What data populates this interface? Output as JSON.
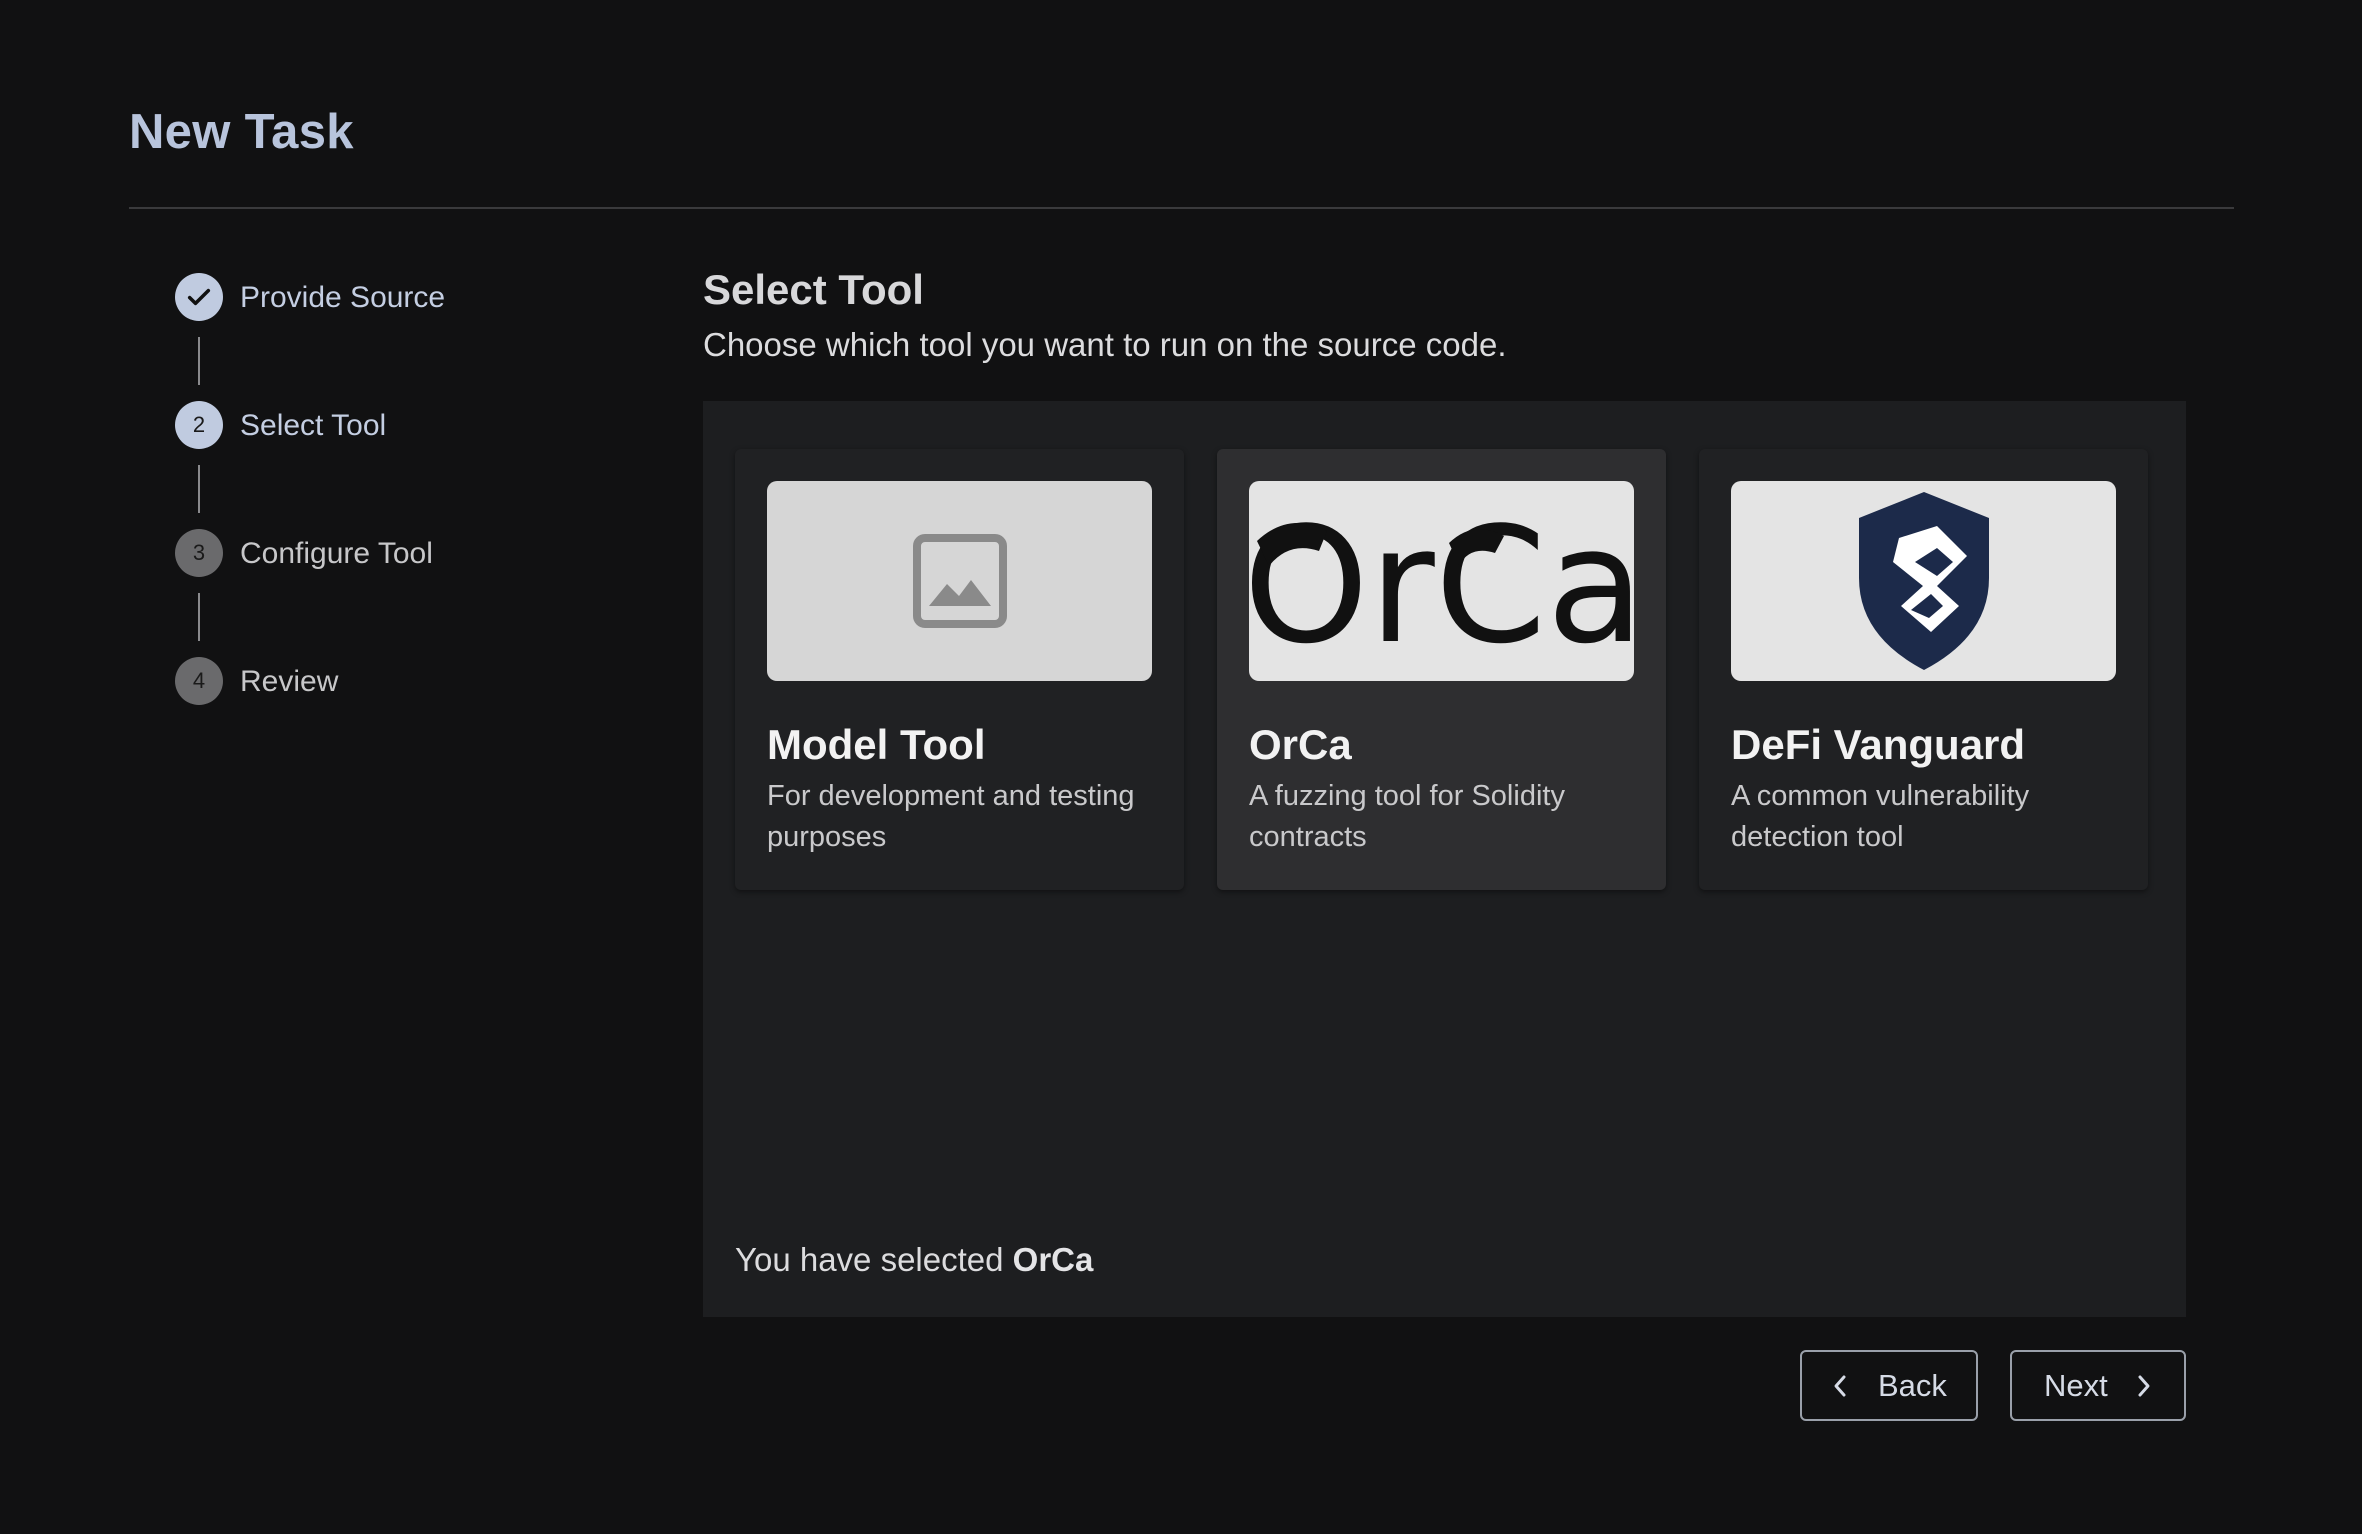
{
  "page": {
    "title": "New Task"
  },
  "stepper": {
    "steps": [
      {
        "number": "1",
        "label": "Provide Source",
        "state": "complete"
      },
      {
        "number": "2",
        "label": "Select Tool",
        "state": "active"
      },
      {
        "number": "3",
        "label": "Configure Tool",
        "state": "upcoming"
      },
      {
        "number": "4",
        "label": "Review",
        "state": "upcoming"
      }
    ]
  },
  "main": {
    "title": "Select Tool",
    "subtitle": "Choose which tool you want to run on the source code.",
    "tools": [
      {
        "name": "Model Tool",
        "description": "For development and testing purposes",
        "image": "image-placeholder-icon",
        "selected": false
      },
      {
        "name": "OrCa",
        "description": "A fuzzing tool for Solidity contracts",
        "image": "orca-logo",
        "logo_text": "OrCa",
        "selected": true
      },
      {
        "name": "DeFi Vanguard",
        "description": "A common vulnerability detection tool",
        "image": "shield-logo",
        "selected": false
      }
    ],
    "selection_prefix": "You have selected ",
    "selection_value": "OrCa"
  },
  "actions": {
    "back_label": "Back",
    "next_label": "Next"
  },
  "colors": {
    "background": "#111112",
    "panel": "#1d1e20",
    "accent": "#c0cbe0",
    "shield": "#1c2a4a"
  }
}
